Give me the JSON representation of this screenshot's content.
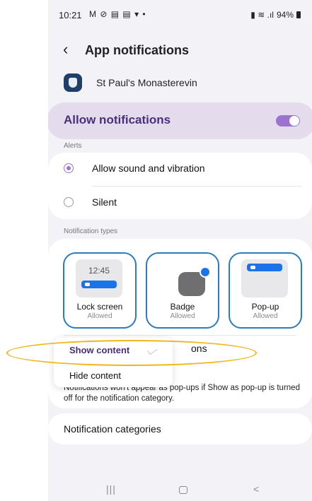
{
  "status_bar": {
    "time": "10:21",
    "left_icons": "M ⊘ ▤ ▤ ▾ •",
    "right_icons": "▮ ≋ .ıl",
    "battery": "94%"
  },
  "header": {
    "back_glyph": "‹",
    "title": "App notifications"
  },
  "app": {
    "name": "St Paul's Monasterevin"
  },
  "allow_notifications": {
    "label": "Allow notifications",
    "enabled": true
  },
  "alerts": {
    "section_label": "Alerts",
    "options": [
      {
        "label": "Allow sound and vibration",
        "selected": true
      },
      {
        "label": "Silent",
        "selected": false
      }
    ]
  },
  "notification_types": {
    "section_label": "Notification types",
    "lock_preview_time": "12:45",
    "items": [
      {
        "name": "Lock screen",
        "status": "Allowed"
      },
      {
        "name": "Badge",
        "status": "Allowed"
      },
      {
        "name": "Pop-up",
        "status": "Allowed"
      }
    ]
  },
  "hidden_row_fragment": "ons",
  "content_dropdown": {
    "options": [
      {
        "label": "Show content",
        "selected": true
      },
      {
        "label": "Hide content",
        "selected": false
      }
    ]
  },
  "popup_note": "Notifications won't appear as pop-ups if Show as pop-up is turned off for the notification category.",
  "categories": {
    "label": "Notification categories"
  },
  "nav_bar": {
    "recents": "|||",
    "back": "<"
  },
  "colors": {
    "accent": "#9b74cf",
    "allow_bg": "#e4dcec",
    "card_border": "#2a7bbf",
    "highlight": "#f2b51a",
    "preview_blue": "#1a73e8"
  }
}
